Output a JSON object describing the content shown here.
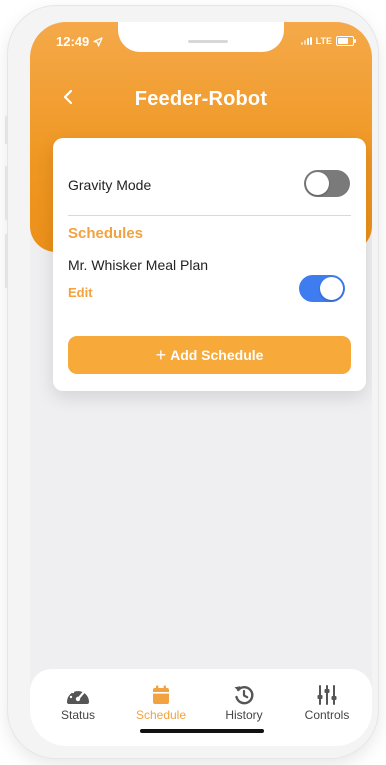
{
  "status_bar": {
    "time": "12:49",
    "network": "LTE"
  },
  "header": {
    "title": "Feeder-Robot"
  },
  "card": {
    "gravity_label": "Gravity Mode",
    "gravity_on": false,
    "schedules_heading": "Schedules",
    "plan_name": "Mr. Whisker Meal Plan",
    "plan_on": true,
    "edit_label": "Edit",
    "add_schedule_label": "Add Schedule"
  },
  "tabs": [
    {
      "label": "Status",
      "icon": "gauge-icon"
    },
    {
      "label": "Schedule",
      "icon": "calendar-icon",
      "active": true
    },
    {
      "label": "History",
      "icon": "history-icon"
    },
    {
      "label": "Controls",
      "icon": "sliders-icon"
    }
  ],
  "colors": {
    "accent": "#F2A23E",
    "toggle_on": "#3E7CF0",
    "toggle_off": "#7A7A7A"
  }
}
